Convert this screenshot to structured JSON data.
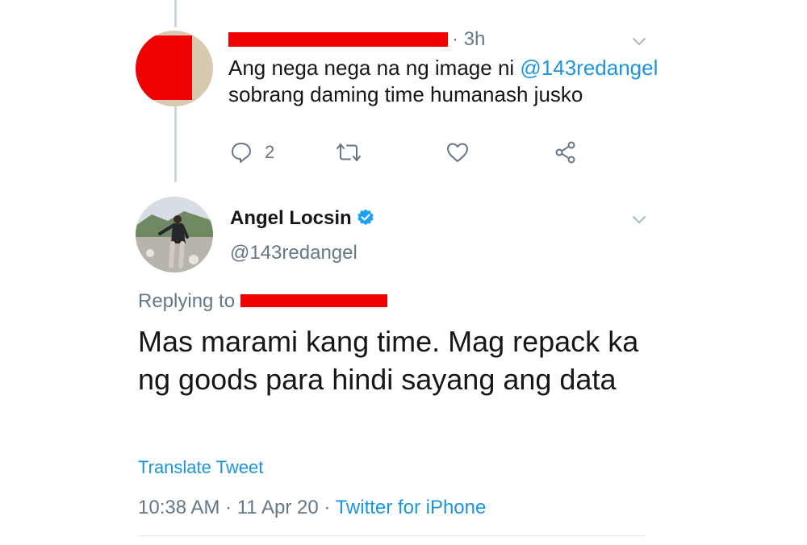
{
  "reply_tweet": {
    "time": "· 3h",
    "text_line1_prefix": "Ang nega nega na ng image ni ",
    "text_mention": "@143redangel",
    "text_line2": "sobrang daming time humanash jusko",
    "reply_count": "2"
  },
  "main_tweet": {
    "author_name": "Angel Locsin",
    "author_handle": "@143redangel",
    "replying_to_label": "Replying to",
    "body": "Mas marami kang time. Mag repack ka ng goods para hindi sayang ang data",
    "translate_label": "Translate Tweet",
    "timestamp": "10:38 AM · 11 Apr 20 · ",
    "source": "Twitter for iPhone"
  },
  "colors": {
    "link": "#1b95e0",
    "secondary_text": "#657786",
    "redaction": "#f10000",
    "verified_badge": "#1da1f2"
  },
  "icons": {
    "reply": "speech-bubble-icon",
    "retweet": "retweet-icon",
    "like": "heart-icon",
    "share": "share-icon",
    "menu": "chevron-down-icon",
    "verified": "verified-badge-icon"
  }
}
